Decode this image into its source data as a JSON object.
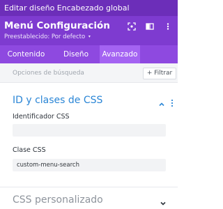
{
  "window": {
    "title": "Editar diseño Encabezado global"
  },
  "module": {
    "title": "Menú Configuración",
    "preset_label": "Preestablecido: Por defecto",
    "preset_chevron": "▾"
  },
  "header_icons": [
    "focus-mode-icon",
    "split-view-icon",
    "more-options-icon"
  ],
  "tabs": [
    {
      "label": "Contenido",
      "active": false
    },
    {
      "label": "Diseño",
      "active": false
    },
    {
      "label": "Avanzado",
      "active": true
    }
  ],
  "search": {
    "placeholder": "Opciones de búsqueda",
    "filter_label": "+ Filtrar"
  },
  "section": {
    "title": "ID y clases de CSS",
    "expanded": true,
    "fields": [
      {
        "label": "Identificador CSS",
        "value": ""
      },
      {
        "label": "Clase CSS",
        "value": "custom-menu-search"
      }
    ]
  },
  "collapsed_section": {
    "title": "CSS personalizado",
    "expanded": false
  },
  "colors": {
    "title_bar": "#6c2eb9",
    "header": "#7e3bd0",
    "tabs": "#8e49e0",
    "active_tab": "#a463f2",
    "section_title": "#2b86d6"
  }
}
